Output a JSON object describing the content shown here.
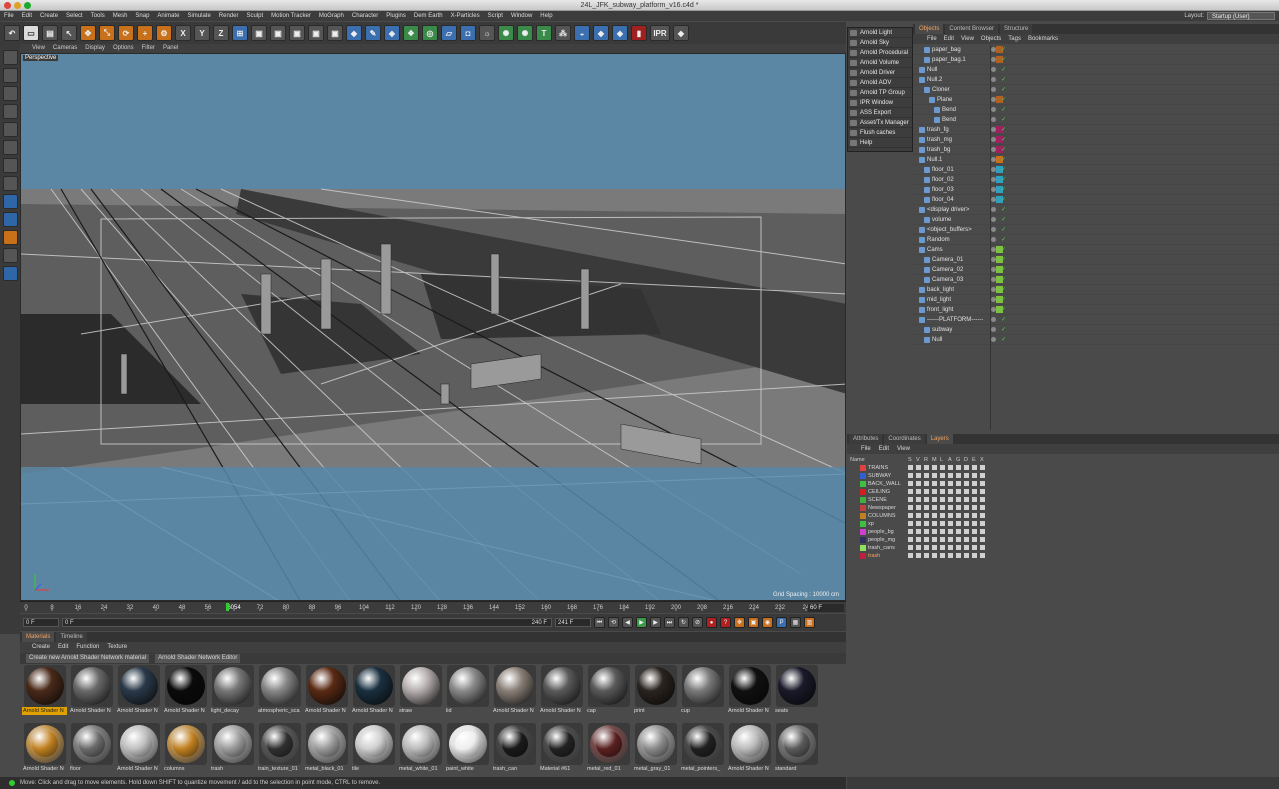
{
  "window": {
    "title": "24L_JFK_subway_platform_v16.c4d *"
  },
  "menubar": [
    "File",
    "Edit",
    "Create",
    "Select",
    "Tools",
    "Mesh",
    "Snap",
    "Animate",
    "Simulate",
    "Render",
    "Sculpt",
    "Motion Tracker",
    "MoGraph",
    "Character",
    "Plugins",
    "Dem Earth",
    "X-Particles",
    "Script",
    "Window",
    "Help"
  ],
  "layout": {
    "label": "Layout:",
    "value": "Startup (User)"
  },
  "toolbar": {
    "axis_x": "X",
    "axis_y": "Y",
    "axis_z": "Z",
    "ipr": "IPR"
  },
  "viewport": {
    "menu": [
      "View",
      "Cameras",
      "Display",
      "Options",
      "Filter",
      "Panel"
    ],
    "label": "Perspective",
    "grid_spacing": "Grid Spacing : 10000 cm"
  },
  "timeline": {
    "ticks": [
      "0",
      "8",
      "16",
      "24",
      "32",
      "40",
      "48",
      "56",
      "6054",
      "72",
      "80",
      "88",
      "96",
      "104",
      "112",
      "120",
      "128",
      "136",
      "144",
      "152",
      "160",
      "168",
      "176",
      "184",
      "192",
      "200",
      "208",
      "216",
      "224",
      "232",
      "24"
    ],
    "frame_display": "60 F"
  },
  "playback": {
    "start": "0 F",
    "current": "0 F",
    "end_min": "240 F",
    "end": "241 F"
  },
  "materials": {
    "tabs": [
      "Materials",
      "Timeline"
    ],
    "menu": [
      "Create",
      "Edit",
      "Function",
      "Texture"
    ],
    "buttons": [
      "Create new Arnold Shader Network material",
      "Arnold Shader Network Editor"
    ],
    "items": [
      {
        "label": "Arnold Shader N",
        "color": "#4a2a1a",
        "selected": true
      },
      {
        "label": "Arnold Shader N",
        "color": "#6a6a6a"
      },
      {
        "label": "Arnold Shader N",
        "color": "#2a3a4a"
      },
      {
        "label": "Arnold Shader N",
        "color": "#0a0a0a"
      },
      {
        "label": "light_decay",
        "color": "#777777"
      },
      {
        "label": "atmospheric_sca",
        "color": "#888888"
      },
      {
        "label": "Arnold Shader N",
        "color": "#5a2a14"
      },
      {
        "label": "Arnold Shader N",
        "color": "#1a3040"
      },
      {
        "label": "straw",
        "color": "#b8b0b0"
      },
      {
        "label": "lid",
        "color": "#8a8a8a"
      },
      {
        "label": "Arnold Shader N",
        "color": "#8a8078"
      },
      {
        "label": "Arnold Shader N",
        "color": "#5a5a5a"
      },
      {
        "label": "cap",
        "color": "#5a5a5a"
      },
      {
        "label": "print",
        "color": "#2a2420"
      },
      {
        "label": "cup",
        "color": "#7a7a7a"
      },
      {
        "label": "Arnold Shader N",
        "color": "#101010"
      },
      {
        "label": "seats",
        "color": "#1a1a2a"
      },
      {
        "label": "Arnold Shader N",
        "color": "#c08020"
      },
      {
        "label": "floor",
        "color": "#6a6a6a"
      },
      {
        "label": "Arnold Shader N",
        "color": "#c0c0c0"
      },
      {
        "label": "columns",
        "color": "#c08020"
      },
      {
        "label": "trash",
        "color": "#9a9a9a"
      },
      {
        "label": "train_texture_01",
        "color": "#303030"
      },
      {
        "label": "metal_black_01",
        "color": "#9a9a9a"
      },
      {
        "label": "tile",
        "color": "#d0d0d0"
      },
      {
        "label": "metal_white_01",
        "color": "#bbbbbb"
      },
      {
        "label": "paint_white",
        "color": "#eeeeee"
      },
      {
        "label": "trash_can",
        "color": "#1a1a1a"
      },
      {
        "label": "Material #61",
        "color": "#222222"
      },
      {
        "label": "metal_red_01",
        "color": "#5a2020"
      },
      {
        "label": "metal_gray_01",
        "color": "#8a8a8a"
      },
      {
        "label": "metal_pointers_",
        "color": "#202020"
      },
      {
        "label": "Arnold Shader N",
        "color": "#bbbbbb"
      },
      {
        "label": "standard",
        "color": "#5a5a5a"
      }
    ]
  },
  "status": "Move: Click and drag to move elements. Hold down SHIFT to quantize movement / add to the selection in point mode, CTRL to remove.",
  "arnold_menu": [
    "Arnold Light",
    "Arnold Sky",
    "Arnold Procedural",
    "Arnold Volume",
    "Arnold Driver",
    "Arnold AOV",
    "Arnold TP Group",
    "IPR Window",
    "ASS Export",
    "Asset/Tx Manager",
    "Flush caches",
    "Help"
  ],
  "objects_panel": {
    "tabs": [
      "Objects",
      "Content Browser",
      "Structure"
    ],
    "menu": [
      "File",
      "Edit",
      "View",
      "Objects",
      "Tags",
      "Bookmarks"
    ],
    "rows": [
      {
        "name": "paper_bag",
        "indent": 1,
        "tag": "#b06020"
      },
      {
        "name": "paper_bag.1",
        "indent": 1,
        "tag": "#b06020"
      },
      {
        "name": "Null",
        "indent": 0,
        "tag": ""
      },
      {
        "name": "Null.2",
        "indent": 0,
        "tag": ""
      },
      {
        "name": "Cloner",
        "indent": 1,
        "tag": ""
      },
      {
        "name": "Plane",
        "indent": 2,
        "tag": "#b06020"
      },
      {
        "name": "Bend",
        "indent": 3,
        "tag": ""
      },
      {
        "name": "Bend",
        "indent": 3,
        "tag": ""
      },
      {
        "name": "trash_fg",
        "indent": 0,
        "tag": "#a02060"
      },
      {
        "name": "trash_mg",
        "indent": 0,
        "tag": "#a02060"
      },
      {
        "name": "trash_bg",
        "indent": 0,
        "tag": "#a02060"
      },
      {
        "name": "Null.1",
        "indent": 0,
        "tag": "#c87020"
      },
      {
        "name": "floor_01",
        "indent": 1,
        "tag": "#30a0c0"
      },
      {
        "name": "floor_02",
        "indent": 1,
        "tag": "#30a0c0"
      },
      {
        "name": "floor_03",
        "indent": 1,
        "tag": "#30a0c0"
      },
      {
        "name": "floor_04",
        "indent": 1,
        "tag": "#30a0c0"
      },
      {
        "name": "<display driver>",
        "indent": 0,
        "tag": ""
      },
      {
        "name": "volume",
        "indent": 1,
        "tag": ""
      },
      {
        "name": "<object_buffers>",
        "indent": 0,
        "tag": ""
      },
      {
        "name": "Random",
        "indent": 0,
        "tag": ""
      },
      {
        "name": "Cams",
        "indent": 0,
        "tag": "#80c040"
      },
      {
        "name": "Camera_01",
        "indent": 1,
        "tag": "#80c040"
      },
      {
        "name": "Camera_02",
        "indent": 1,
        "tag": "#80c040"
      },
      {
        "name": "Camera_03",
        "indent": 1,
        "tag": "#80c040"
      },
      {
        "name": "back_light",
        "indent": 0,
        "tag": "#80c040"
      },
      {
        "name": "mid_light",
        "indent": 0,
        "tag": "#80c040"
      },
      {
        "name": "front_light",
        "indent": 0,
        "tag": "#80c040"
      },
      {
        "name": "------PLATFORM------",
        "indent": 0,
        "tag": ""
      },
      {
        "name": "subway",
        "indent": 1,
        "tag": ""
      },
      {
        "name": "Null",
        "indent": 1,
        "tag": ""
      }
    ]
  },
  "layers_panel": {
    "tabs": [
      "Attributes",
      "Coordinates",
      "Layers"
    ],
    "menu": [
      "File",
      "Edit",
      "View"
    ],
    "columns": [
      "Name",
      "S",
      "V",
      "R",
      "M",
      "L",
      "A",
      "G",
      "D",
      "E",
      "X"
    ],
    "rows": [
      {
        "name": "TRAINS",
        "color": "#e04040"
      },
      {
        "name": "SUBWAY",
        "color": "#3060d0"
      },
      {
        "name": "BACK_WALL",
        "color": "#40c040"
      },
      {
        "name": "CEILING",
        "color": "#d02020"
      },
      {
        "name": "SCENE",
        "color": "#40b040"
      },
      {
        "name": "Newspaper",
        "color": "#c04040"
      },
      {
        "name": "COLUMNS",
        "color": "#c08020"
      },
      {
        "name": "xp",
        "color": "#40c040"
      },
      {
        "name": "people_bg",
        "color": "#d040d0"
      },
      {
        "name": "people_mg",
        "color": "#303060"
      },
      {
        "name": "trash_cans",
        "color": "#90e060"
      },
      {
        "name": "trash",
        "color": "#c02040"
      }
    ]
  }
}
